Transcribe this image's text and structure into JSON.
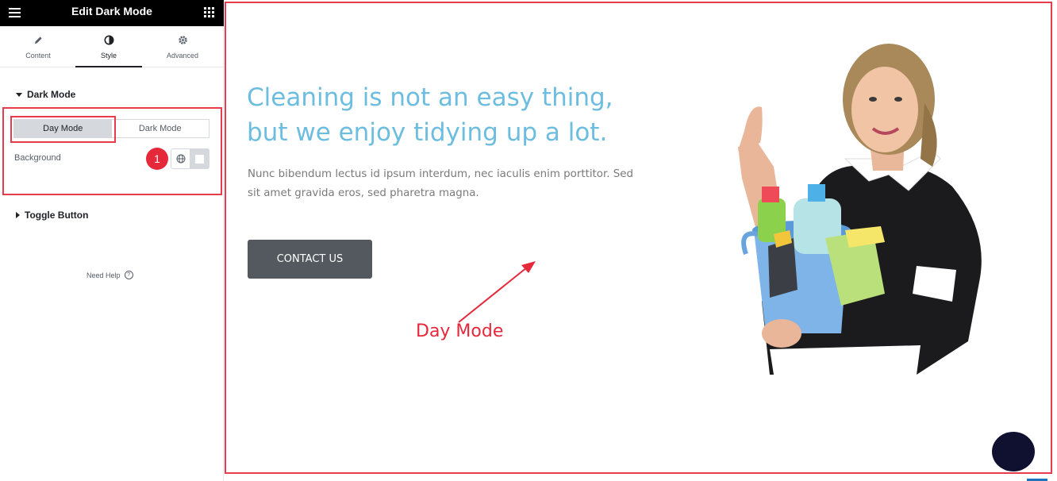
{
  "editor": {
    "title": "Edit Dark Mode",
    "tabs": [
      {
        "label": "Content",
        "icon": "pencil-icon"
      },
      {
        "label": "Style",
        "icon": "half-circle-icon"
      },
      {
        "label": "Advanced",
        "icon": "gear-icon"
      }
    ],
    "active_tab": "Style",
    "sections": {
      "dark_mode": {
        "title": "Dark Mode",
        "modes": [
          "Day Mode",
          "Dark Mode"
        ],
        "selected_mode": "Day Mode",
        "background_label": "Background",
        "step_badge": "1"
      },
      "toggle_button": {
        "title": "Toggle Button"
      }
    },
    "help": "Need Help",
    "help_glyph": "?"
  },
  "preview": {
    "headline_line1": "Cleaning is not an easy thing,",
    "headline_line2": "but we enjoy tidying up a lot.",
    "body": "Nunc bibendum lectus id ipsum interdum, nec iaculis enim porttitor. Sed sit amet gravida eros, sed pharetra magna.",
    "cta_label": "CONTACT US",
    "annotation": "Day Mode"
  },
  "colors": {
    "accent_red": "#e63c4b",
    "headline": "#6cbde0",
    "button": "#54595f",
    "fab": "#101131"
  }
}
